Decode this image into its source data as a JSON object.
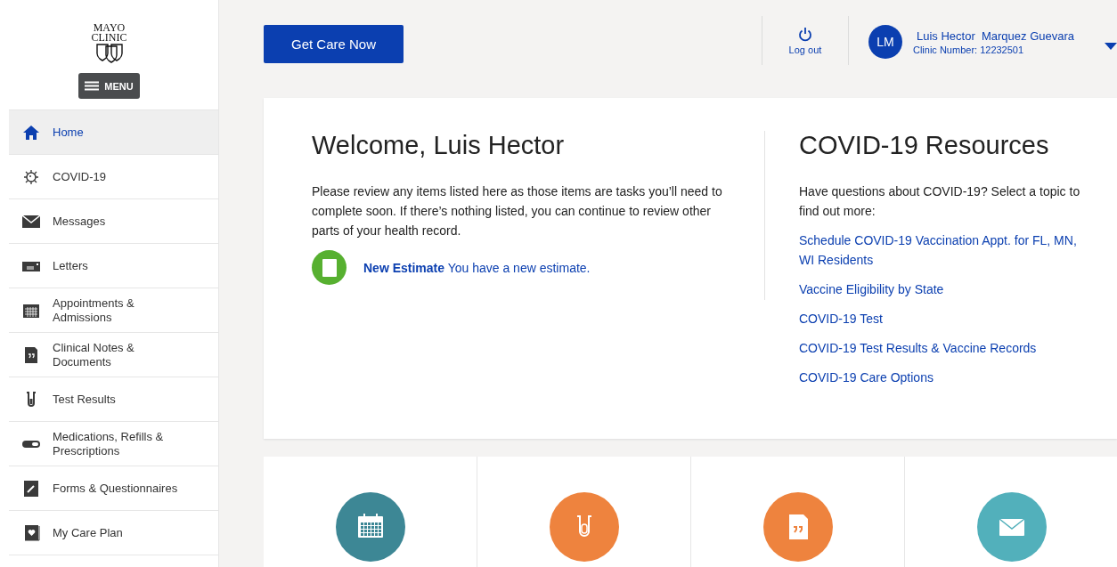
{
  "sidebar": {
    "logo": {
      "line_1": "MAYO",
      "line_2": "CLINIC"
    },
    "menu_button": "MENU",
    "items": [
      {
        "label": "Home",
        "selected": true
      },
      {
        "label": "COVID-19",
        "selected": false
      },
      {
        "label": "Messages",
        "selected": false
      },
      {
        "label": "Letters",
        "selected": false
      },
      {
        "label": "Appointments & Admissions",
        "selected": false
      },
      {
        "label": "Clinical Notes & Documents",
        "selected": false
      },
      {
        "label": "Test Results",
        "selected": false
      },
      {
        "label": "Medications, Refills & Prescriptions",
        "selected": false
      },
      {
        "label": "Forms & Questionnaires",
        "selected": false
      },
      {
        "label": "My Care Plan",
        "selected": false
      }
    ]
  },
  "header": {
    "get_care_button": "Get Care Now",
    "logout": "Log out",
    "user": {
      "initials": "LM",
      "name": "Luis Hector  Marquez Guevara",
      "clinic_number": "Clinic Number: 12232501"
    }
  },
  "welcome": {
    "title": "Welcome, Luis Hector",
    "text": "Please review any items listed here as those items are tasks you’ll need to complete soon. If there’s nothing listed, you can continue to review other parts of your health record.",
    "notice": "**New Estimate** You have a new estimate."
  },
  "covid_resources": {
    "title": "COVID-19 Resources",
    "text": "Have questions about COVID-19? Select a topic to find out more:",
    "links": [
      "Schedule COVID-19 Vaccination Appt. for FL, MN, WI Residents",
      "Vaccine Eligibility by State",
      "COVID-19 Test",
      "COVID-19 Test Results & Vaccine Records",
      "COVID-19 Care Options"
    ]
  },
  "tiles": [
    {
      "color": "#3d8795"
    },
    {
      "color": "#ee833e"
    },
    {
      "color": "#ee833e"
    },
    {
      "color": "#52b0bb"
    }
  ]
}
